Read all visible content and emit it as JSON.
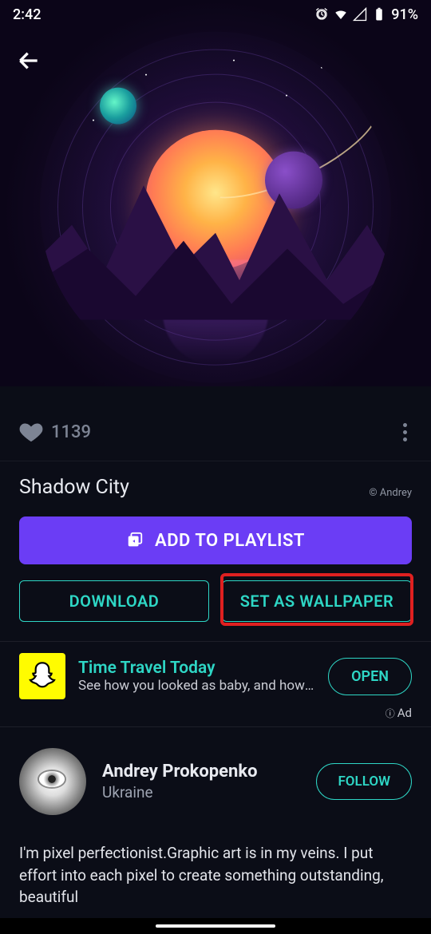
{
  "status": {
    "time": "2:42",
    "battery": "91%"
  },
  "wallpaper": {
    "title": "Shadow City",
    "credit": "© Andrey",
    "likes": "1139"
  },
  "buttons": {
    "add_playlist": "ADD TO PLAYLIST",
    "download": "DOWNLOAD",
    "set_wallpaper": "SET AS WALLPAPER"
  },
  "ad": {
    "title": "Time Travel Today",
    "subtitle": "See how you looked as baby, and how y…",
    "cta": "OPEN",
    "label": "Ad"
  },
  "author": {
    "name": "Andrey Prokopenko",
    "location": "Ukraine",
    "follow": "FOLLOW",
    "bio": "I'm pixel perfectionist.Graphic art is in my veins. I put effort into each pixel to create something outstanding, beautiful"
  }
}
